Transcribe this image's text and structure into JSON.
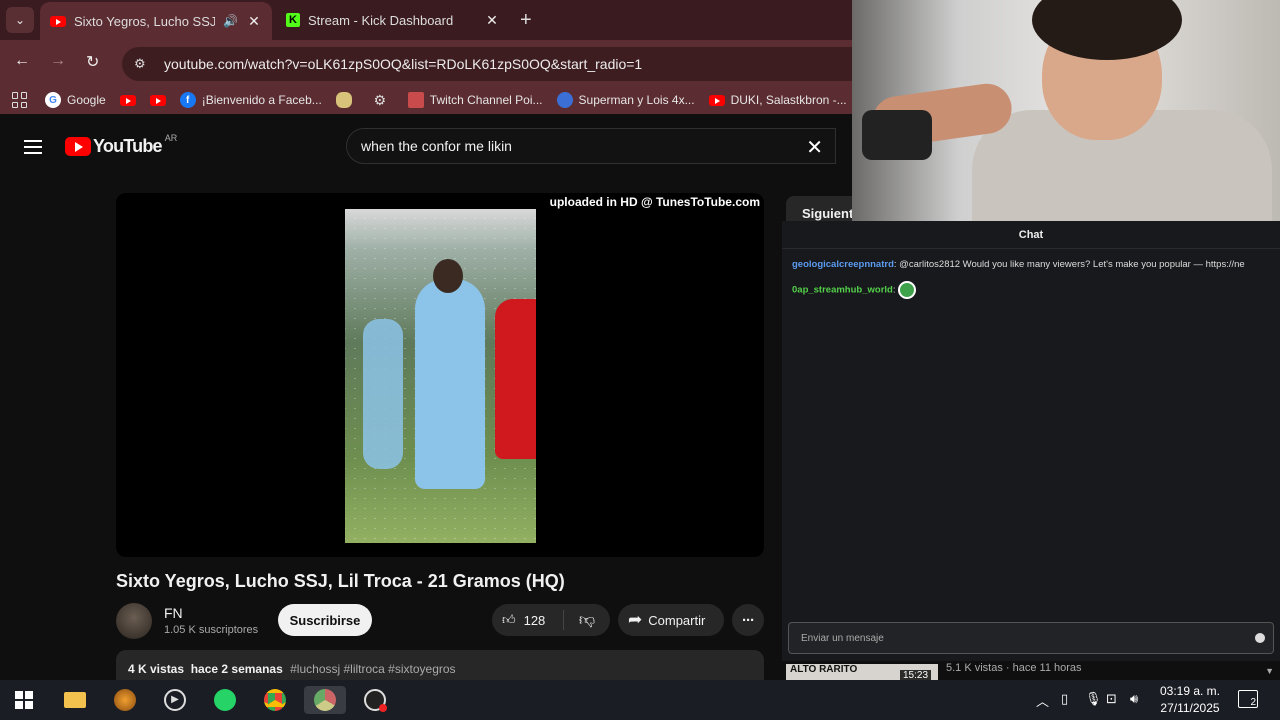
{
  "browser": {
    "tabs": [
      {
        "title": "Sixto Yegros, Lucho SSJ, Lil T",
        "active": true,
        "favicon": "youtube-icon"
      },
      {
        "title": "Stream - Kick Dashboard",
        "active": false,
        "favicon": "kick-icon"
      }
    ],
    "url": "youtube.com/watch?v=oLK61zpS0OQ&list=RDoLK61zpS0OQ&start_radio=1",
    "bookmarks": [
      {
        "label": "Google",
        "icon": "google-icon"
      },
      {
        "label": "",
        "icon": "youtube-icon"
      },
      {
        "label": "",
        "icon": "youtube-icon"
      },
      {
        "label": "¡Bienvenido a Faceb...",
        "icon": "facebook-icon"
      },
      {
        "label": "",
        "icon": "bookmark-icon"
      },
      {
        "label": "",
        "icon": "gear-icon"
      },
      {
        "label": "Twitch Channel Poi...",
        "icon": "twitch-icon"
      },
      {
        "label": "Superman y Lois 4x...",
        "icon": "globe-icon"
      },
      {
        "label": "DUKI, Salastkbron -...",
        "icon": "youtube-icon"
      }
    ]
  },
  "youtube": {
    "logo_text": "YouTube",
    "country_code": "AR",
    "search_query": "when the confor me likin",
    "player_watermark": "uploaded in HD @ TunesToTube.com",
    "video_title": "Sixto Yegros, Lucho SSJ, Lil Troca - 21 Gramos (HQ)",
    "channel_name": "FN",
    "subscribers": "1.05 K suscriptores",
    "subscribe_label": "Suscribirse",
    "likes": "128",
    "share_label": "Compartir",
    "views": "4 K vistas",
    "date": "hace 2 semanas",
    "tags": "#luchossj #liltroca #sixtoyegros",
    "next_label": "Siguiente",
    "rec_thumb_text": "ALTO RARITO",
    "rec_duration": "15:23",
    "rec_meta": "5.1 K vistas · hace 11 horas"
  },
  "chat": {
    "title": "Chat",
    "messages": [
      {
        "user": "geologicalcreepnnatrd",
        "user_color": "#5b9bf0",
        "text": ": @carlitos2812 Would you like many viewers? Let's make you popular — https://ne"
      },
      {
        "user": "0ap_streamhub_world",
        "user_color": "#53d14a",
        "text": ": "
      }
    ],
    "input_placeholder": "Enviar un mensaje"
  },
  "taskbar": {
    "time": "03:19 a. m.",
    "date": "27/11/2025",
    "notifications": "2"
  }
}
